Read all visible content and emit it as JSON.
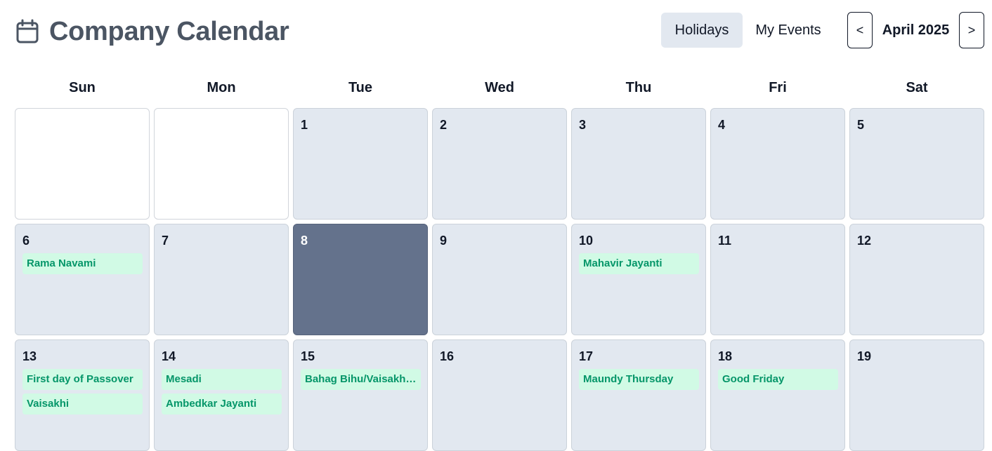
{
  "header": {
    "title": "Company Calendar",
    "icon": "calendar-icon",
    "tabs": [
      {
        "label": "Holidays",
        "active": true
      },
      {
        "label": "My Events",
        "active": false
      }
    ],
    "prev_label": "<",
    "next_label": ">",
    "month_label": "April 2025"
  },
  "weekdays": [
    "Sun",
    "Mon",
    "Tue",
    "Wed",
    "Thu",
    "Fri",
    "Sat"
  ],
  "calendar": {
    "today": "8",
    "weeks": [
      [
        {
          "day": "",
          "events": []
        },
        {
          "day": "",
          "events": []
        },
        {
          "day": "1",
          "events": []
        },
        {
          "day": "2",
          "events": []
        },
        {
          "day": "3",
          "events": []
        },
        {
          "day": "4",
          "events": []
        },
        {
          "day": "5",
          "events": []
        }
      ],
      [
        {
          "day": "6",
          "events": [
            "Rama Navami"
          ]
        },
        {
          "day": "7",
          "events": []
        },
        {
          "day": "8",
          "events": []
        },
        {
          "day": "9",
          "events": []
        },
        {
          "day": "10",
          "events": [
            "Mahavir Jayanti"
          ]
        },
        {
          "day": "11",
          "events": []
        },
        {
          "day": "12",
          "events": []
        }
      ],
      [
        {
          "day": "13",
          "events": [
            "First day of Passover",
            "Vaisakhi"
          ]
        },
        {
          "day": "14",
          "events": [
            "Mesadi",
            "Ambedkar Jayanti"
          ]
        },
        {
          "day": "15",
          "events": [
            "Bahag Bihu/Vaisakhadi"
          ]
        },
        {
          "day": "16",
          "events": []
        },
        {
          "day": "17",
          "events": [
            "Maundy Thursday"
          ]
        },
        {
          "day": "18",
          "events": [
            "Good Friday"
          ]
        },
        {
          "day": "19",
          "events": []
        }
      ]
    ]
  },
  "colors": {
    "title": "#4b5563",
    "cell_bg": "#e2e8f0",
    "today_bg": "#64728c",
    "event_bg": "#d1fae5",
    "event_text": "#059669"
  }
}
